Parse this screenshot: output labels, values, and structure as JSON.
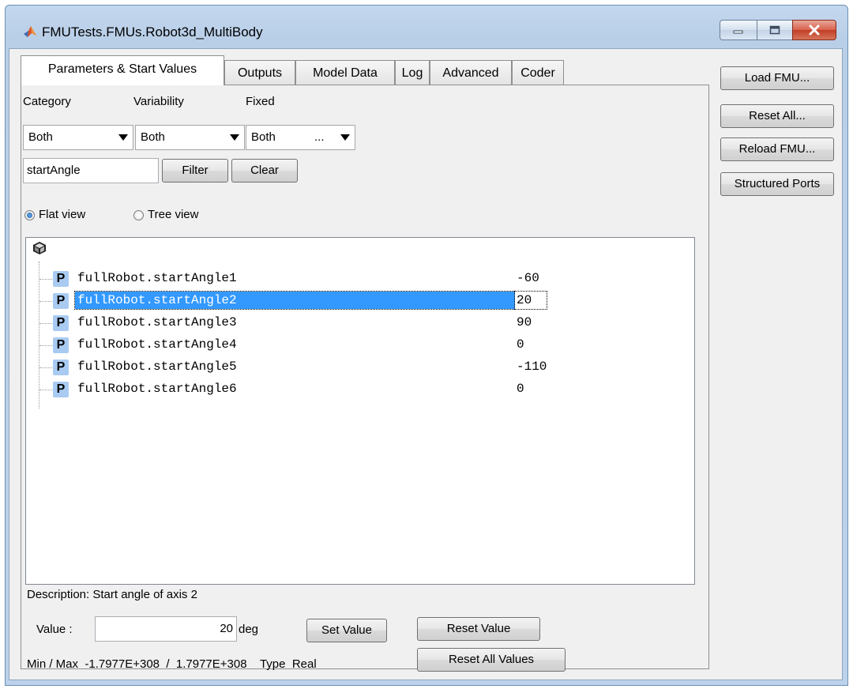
{
  "window": {
    "title": "FMUTests.FMUs.Robot3d_MultiBody",
    "controls": [
      "minimize",
      "maximize",
      "close"
    ]
  },
  "tabs": [
    {
      "label": "Parameters & Start Values",
      "active": true
    },
    {
      "label": "Outputs",
      "active": false
    },
    {
      "label": "Model Data",
      "active": false
    },
    {
      "label": "Log",
      "active": false
    },
    {
      "label": "Advanced",
      "active": false
    },
    {
      "label": "Coder",
      "active": false
    }
  ],
  "filters": {
    "category_label": "Category",
    "variability_label": "Variability",
    "fixed_label": "Fixed",
    "category_value": "Both",
    "variability_value": "Both",
    "fixed_value": "Both",
    "fixed_extra": "...",
    "search_value": "startAngle",
    "filter_button": "Filter",
    "clear_button": "Clear"
  },
  "view": {
    "flat_label": "Flat view",
    "tree_label": "Tree view",
    "selected": "flat"
  },
  "parameters": [
    {
      "icon": "P",
      "name": "fullRobot.startAngle1",
      "value": "-60"
    },
    {
      "icon": "P",
      "name": "fullRobot.startAngle2",
      "value": "20",
      "selected": true
    },
    {
      "icon": "P",
      "name": "fullRobot.startAngle3",
      "value": "90"
    },
    {
      "icon": "P",
      "name": "fullRobot.startAngle4",
      "value": "0"
    },
    {
      "icon": "P",
      "name": "fullRobot.startAngle5",
      "value": "-110"
    },
    {
      "icon": "P",
      "name": "fullRobot.startAngle6",
      "value": "0"
    }
  ],
  "details": {
    "description": "Description: Start angle of axis 2",
    "value_label": "Value :",
    "value": "20",
    "unit": "deg",
    "set_value_button": "Set Value",
    "reset_value_button": "Reset Value",
    "reset_all_values_button": "Reset All Values",
    "minmax_label": "Min / Max",
    "min": "-1.7977E+308",
    "separator": "/",
    "max": "1.7977E+308",
    "type_label": "Type",
    "type": "Real"
  },
  "side_buttons": {
    "load_fmu": "Load FMU...",
    "reset_all": "Reset All...",
    "reload_fmu": "Reload FMU...",
    "structured_ports": "Structured Ports"
  },
  "colors": {
    "selection": "#3399ff",
    "param_icon": "#a9cbf2",
    "close_button": "#c13e26"
  }
}
